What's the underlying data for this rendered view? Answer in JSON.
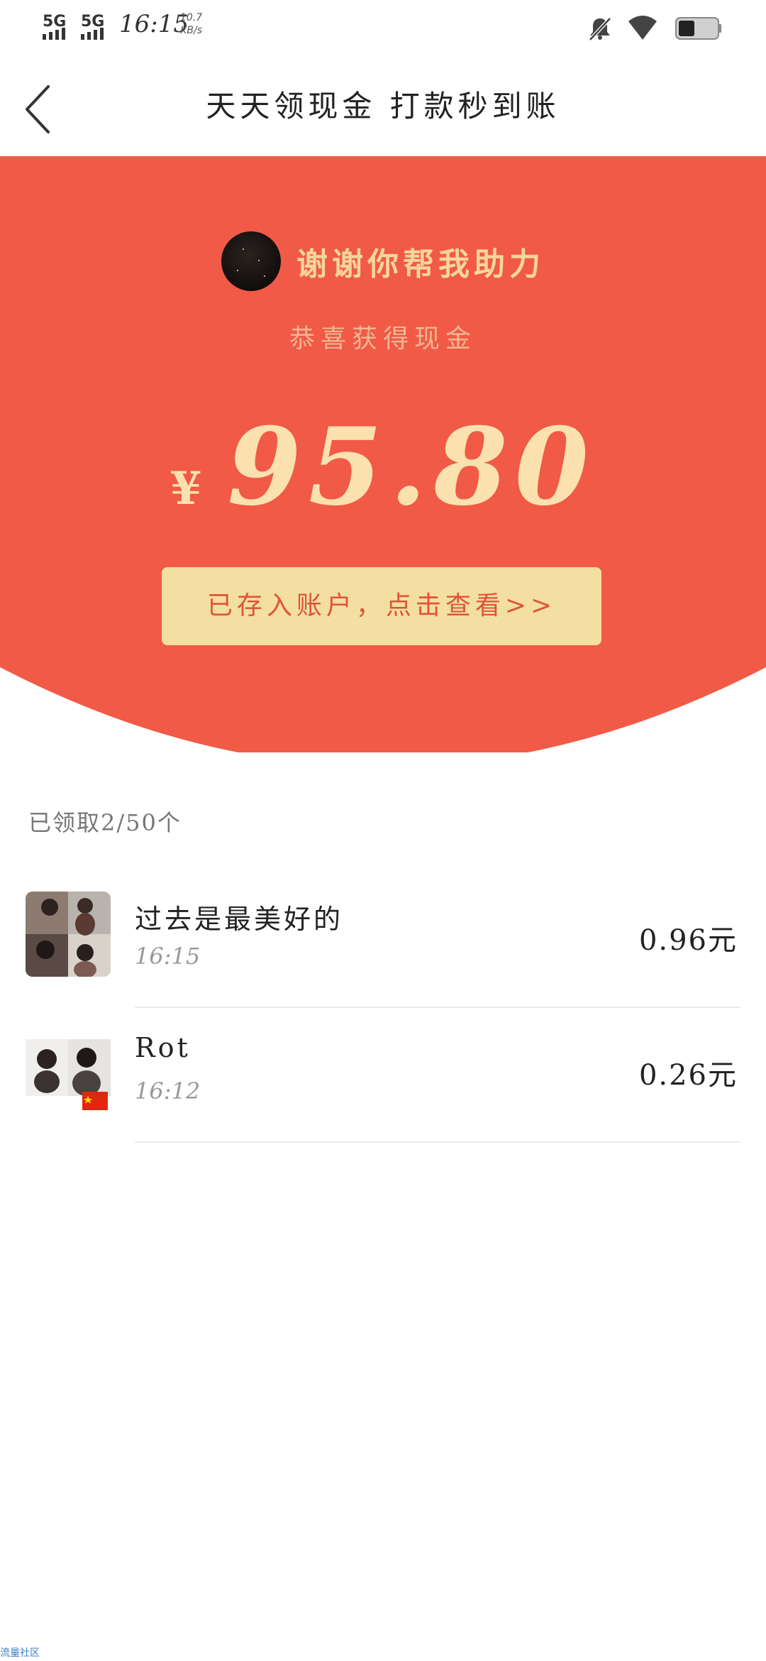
{
  "status_bar": {
    "network_1": "5G",
    "network_2": "5G",
    "time": "16:15",
    "speed_value": "10.7",
    "speed_unit": "KB/s",
    "icons": [
      "mute-icon",
      "wifi-icon",
      "battery-icon"
    ]
  },
  "header": {
    "title": "天天领现金 打款秒到账",
    "back_icon": "chevron-left-icon"
  },
  "banner": {
    "background_color": "#f05a46",
    "thanks_text": "谢谢你帮我助力",
    "congrats_text": "恭喜获得现金",
    "currency": "¥",
    "amount": "95.80",
    "deposit_button_label": "已存入账户，点击查看>>"
  },
  "claimed": {
    "count_label": "已领取2/50个",
    "items": [
      {
        "name": "过去是最美好的",
        "time": "16:15",
        "amount": "0.96元"
      },
      {
        "name": "Rot",
        "time": "16:12",
        "amount": "0.26元"
      }
    ]
  },
  "footer": {
    "watermark": "流量社区"
  }
}
